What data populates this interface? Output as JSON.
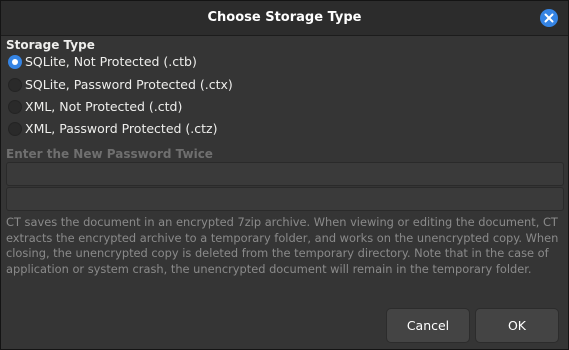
{
  "window": {
    "title": "Choose Storage Type",
    "close_icon": "close-icon"
  },
  "storage": {
    "heading": "Storage Type",
    "options": [
      {
        "label": "SQLite, Not Protected (.ctb)",
        "selected": true
      },
      {
        "label": "SQLite, Password Protected (.ctx)",
        "selected": false
      },
      {
        "label": "XML, Not Protected (.ctd)",
        "selected": false
      },
      {
        "label": "XML, Password Protected (.ctz)",
        "selected": false
      }
    ]
  },
  "password": {
    "heading": "Enter the New Password Twice",
    "field1_value": "",
    "field2_value": ""
  },
  "info_text": "CT saves the document in an encrypted 7zip archive. When viewing or editing the document, CT extracts the encrypted archive to a temporary folder, and works on the unencrypted copy. When closing, the unencrypted copy is deleted from the temporary directory. Note that in the case of application or system crash, the unencrypted document will remain in the temporary folder.",
  "buttons": {
    "cancel": "Cancel",
    "ok": "OK"
  },
  "colors": {
    "accent": "#3584e4",
    "background": "#353535",
    "disabled_text": "#8a8a8a"
  }
}
